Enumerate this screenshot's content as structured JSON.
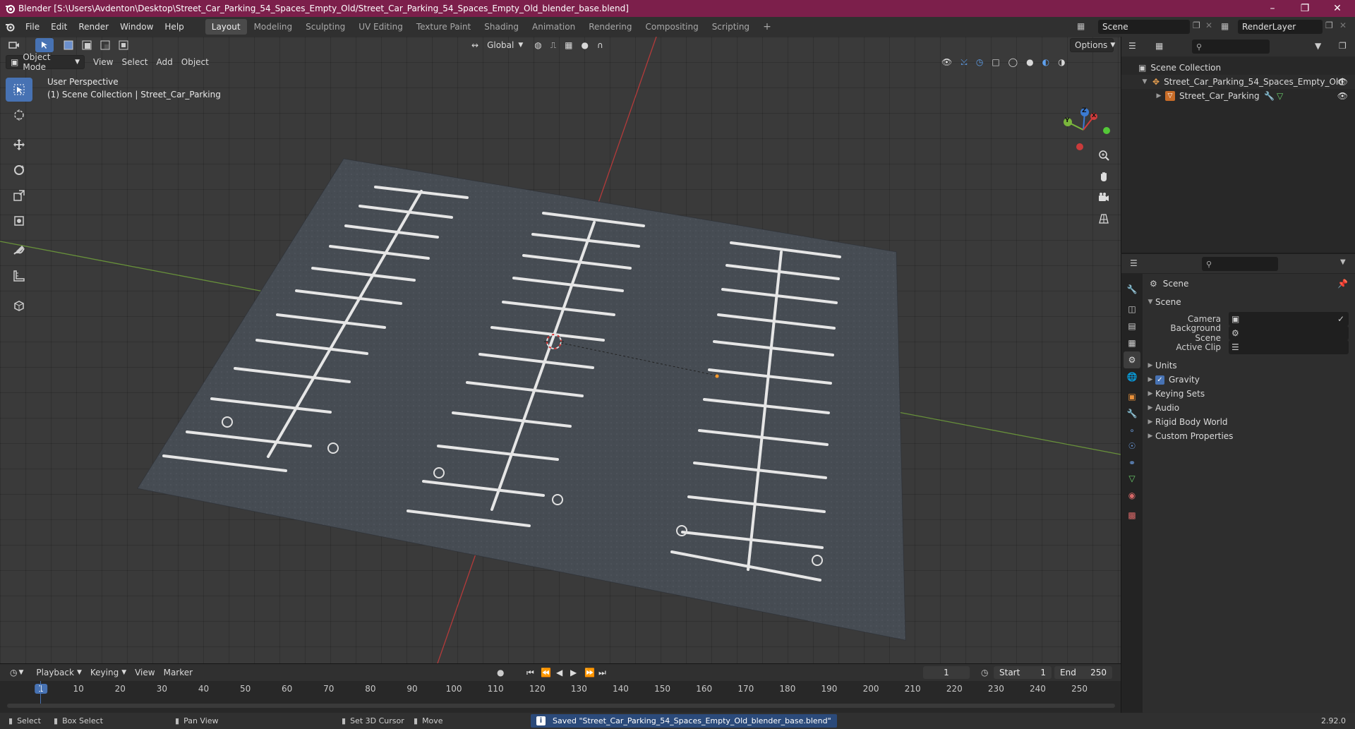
{
  "window": {
    "title": "Blender [S:\\Users\\Avdenton\\Desktop\\Street_Car_Parking_54_Spaces_Empty_Old/Street_Car_Parking_54_Spaces_Empty_Old_blender_base.blend]"
  },
  "menu": [
    "File",
    "Edit",
    "Render",
    "Window",
    "Help"
  ],
  "workspaces": [
    "Layout",
    "Modeling",
    "Sculpting",
    "UV Editing",
    "Texture Paint",
    "Shading",
    "Animation",
    "Rendering",
    "Compositing",
    "Scripting"
  ],
  "active_workspace": "Layout",
  "scene_field": "Scene",
  "view_layer_field": "RenderLayer",
  "viewport": {
    "mode": "Object Mode",
    "menus": [
      "View",
      "Select",
      "Add",
      "Object"
    ],
    "transform_orientation": "Global",
    "options_label": "Options",
    "overlay_line1": "User Perspective",
    "overlay_line2": "(1) Scene Collection | Street_Car_Parking",
    "gizmo": {
      "x": "X",
      "y": "Y",
      "z": "Z"
    }
  },
  "outliner": {
    "root": "Scene Collection",
    "items": [
      {
        "label": "Street_Car_Parking_54_Spaces_Empty_Old"
      },
      {
        "label": "Street_Car_Parking"
      }
    ]
  },
  "properties": {
    "context": "Scene",
    "panel_title": "Scene",
    "fields": [
      {
        "label": "Camera",
        "value": ""
      },
      {
        "label": "Background Scene",
        "value": ""
      },
      {
        "label": "Active Clip",
        "value": ""
      }
    ],
    "sections": [
      "Units",
      "Gravity",
      "Keying Sets",
      "Audio",
      "Rigid Body World",
      "Custom Properties"
    ],
    "gravity_checked": true
  },
  "timeline": {
    "menus": [
      "Playback",
      "Keying",
      "View",
      "Marker"
    ],
    "current_frame": "1",
    "start_label": "Start",
    "start_value": "1",
    "end_label": "End",
    "end_value": "250",
    "ruler": [
      "1",
      "10",
      "20",
      "30",
      "40",
      "50",
      "60",
      "70",
      "80",
      "90",
      "100",
      "110",
      "120",
      "130",
      "140",
      "150",
      "160",
      "170",
      "180",
      "190",
      "200",
      "210",
      "220",
      "230",
      "240",
      "250"
    ]
  },
  "statusbar": {
    "select": "Select",
    "box_select": "Box Select",
    "pan_view": "Pan View",
    "set_cursor": "Set 3D Cursor",
    "move": "Move",
    "message": "Saved \"Street_Car_Parking_54_Spaces_Empty_Old_blender_base.blend\"",
    "version": "2.92.0"
  },
  "colors": {
    "title_bar": "#7c1f4b",
    "accent": "#4772b3",
    "x_axis": "#d23b3b",
    "y_axis": "#7ab63c",
    "z_axis": "#3b7bd2"
  }
}
